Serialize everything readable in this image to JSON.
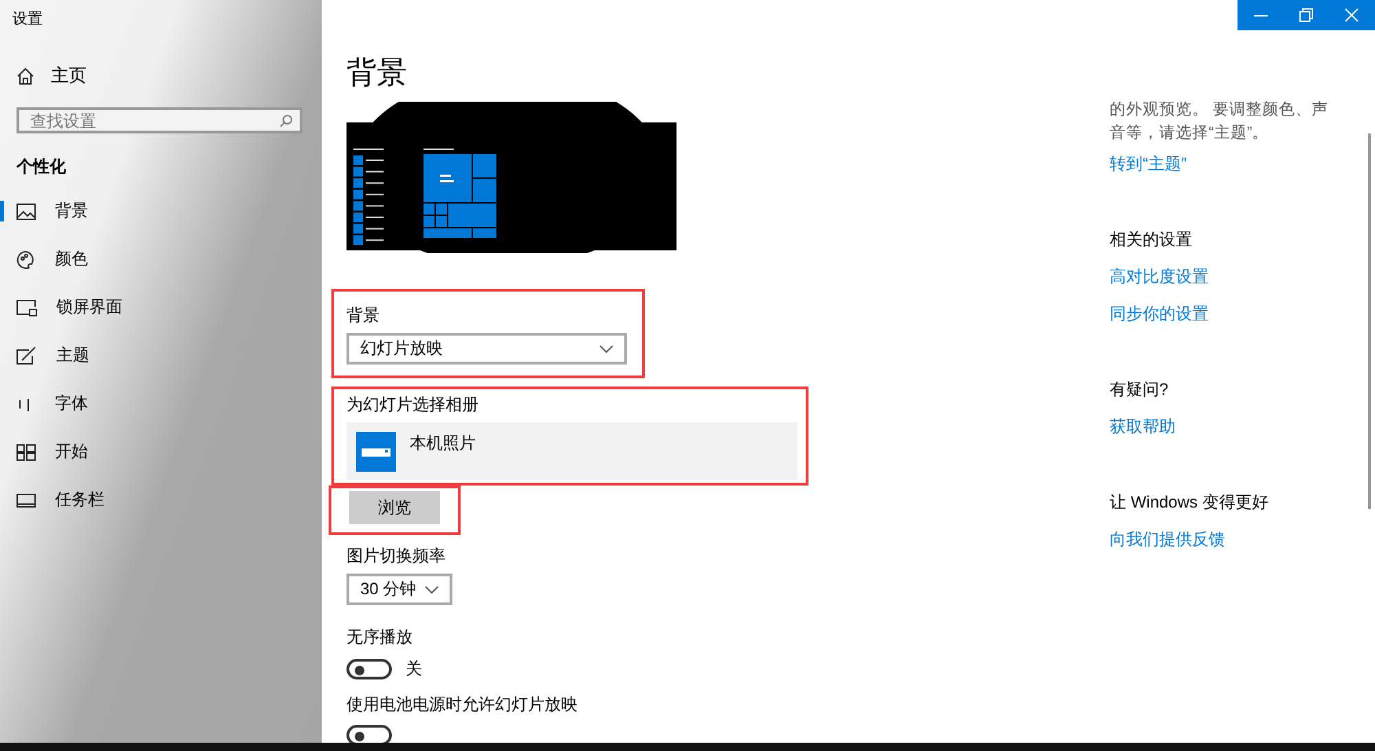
{
  "window": {
    "title": "设置"
  },
  "sidebar": {
    "home": "主页",
    "search": {
      "placeholder": "查找设置"
    },
    "section": "个性化",
    "items": [
      {
        "label": "背景",
        "kind": "background",
        "selected": true
      },
      {
        "label": "颜色",
        "kind": "colors",
        "selected": false
      },
      {
        "label": "锁屏界面",
        "kind": "lock",
        "selected": false
      },
      {
        "label": "主题",
        "kind": "themes",
        "selected": false
      },
      {
        "label": "字体",
        "kind": "fonts",
        "selected": false
      },
      {
        "label": "开始",
        "kind": "start",
        "selected": false
      },
      {
        "label": "任务栏",
        "kind": "taskbar",
        "selected": false
      }
    ]
  },
  "page": {
    "title": "背景",
    "background": {
      "label": "背景",
      "value": "幻灯片放映",
      "highlighted": true
    },
    "album": {
      "label": "为幻灯片选择相册",
      "name": "本机照片",
      "highlighted": true
    },
    "browse": {
      "label": "浏览",
      "highlighted": true
    },
    "interval": {
      "label": "图片切换频率",
      "value": "30 分钟"
    },
    "toggles": [
      {
        "label": "无序播放",
        "on": false,
        "state": "关"
      },
      {
        "label": "使用电池电源时允许幻灯片放映",
        "on": false
      }
    ]
  },
  "aside": {
    "intro": "的外观预览。 要调整颜色、声音等，请选择“主题”。",
    "intro_link": "转到“主题”",
    "groups": [
      {
        "title": "相关的设置",
        "links": [
          "高对比度设置",
          "同步你的设置"
        ]
      },
      {
        "title": "有疑问?",
        "links": [
          "获取帮助"
        ]
      },
      {
        "title": "让 Windows 变得更好",
        "links": [
          "向我们提供反馈"
        ]
      }
    ]
  }
}
